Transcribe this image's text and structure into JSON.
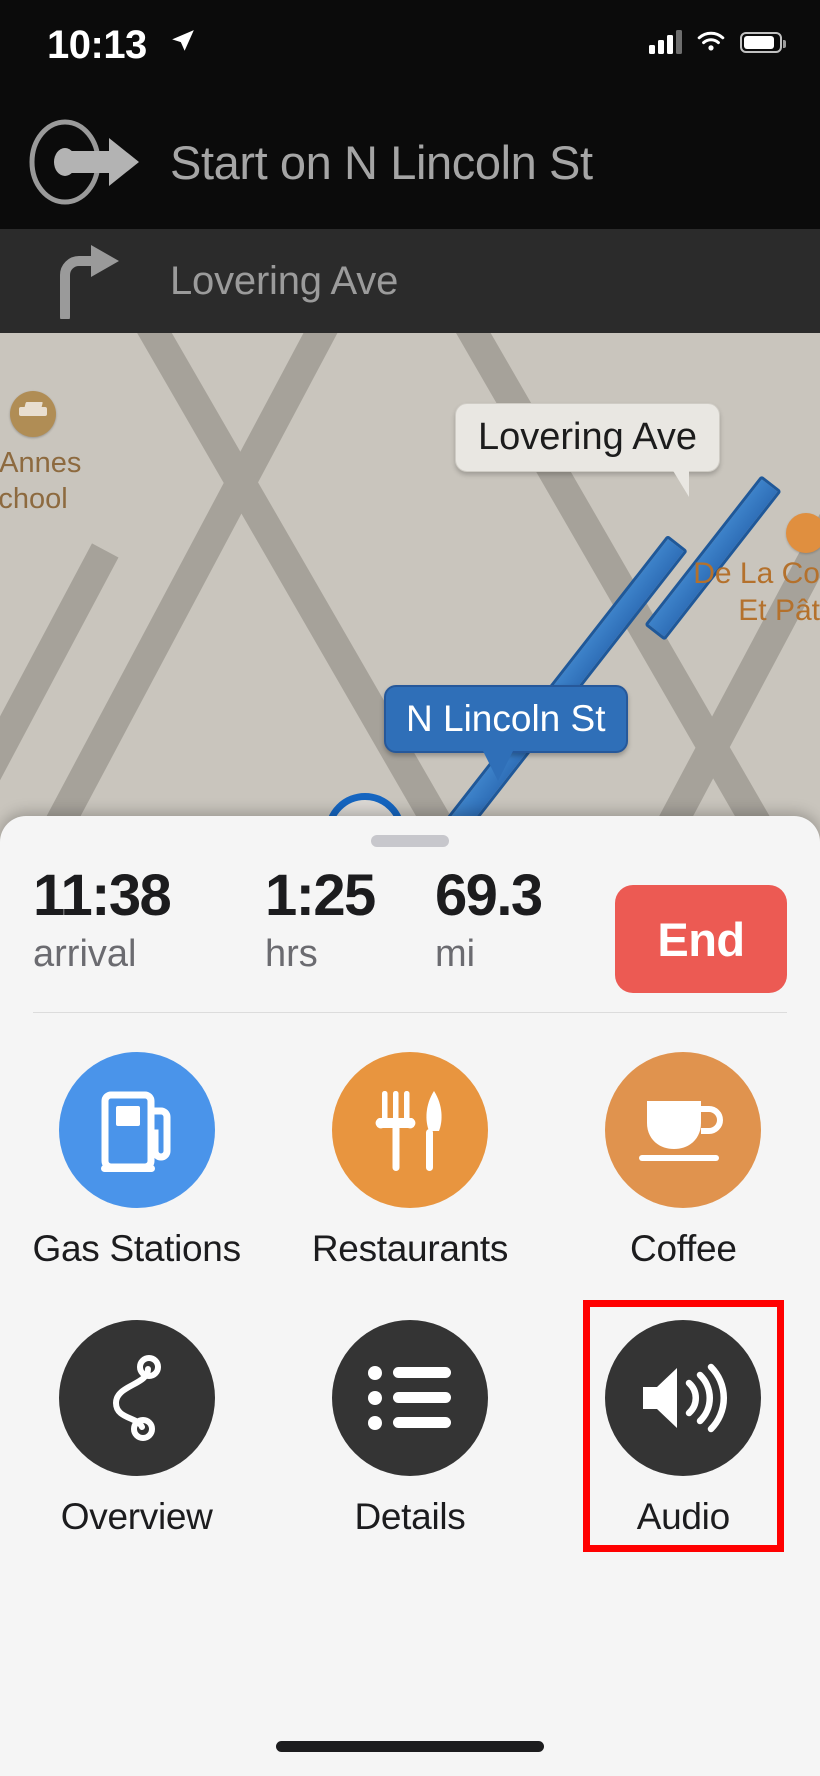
{
  "status_bar": {
    "time": "10:13",
    "location_icon": "location-arrow-icon",
    "cellular_icon": "cellular-bars-icon",
    "wifi_icon": "wifi-icon",
    "battery_icon": "battery-icon"
  },
  "navigation": {
    "primary": {
      "instruction": "Start on N Lincoln St",
      "maneuver_icon": "depart-arrow-icon"
    },
    "secondary": {
      "instruction": "Lovering Ave",
      "maneuver_icon": "turn-right-icon"
    }
  },
  "map": {
    "poi_school": {
      "line1": "t Annes",
      "line2": "chool",
      "icon": "school-graduation-cap-icon"
    },
    "poi_patisserie": {
      "line1": "De La Co",
      "line2": "Et Pât",
      "icon": "cafe-pin-icon"
    },
    "street_callout_lovering": "Lovering Ave",
    "street_callout_lincoln": "N Lincoln St",
    "user_location_icon": "location-puck-icon",
    "route_color": "#2f6fb8"
  },
  "sheet": {
    "grabber_icon": "sheet-grabber-handle",
    "stats": [
      {
        "value": "11:38",
        "unit": "arrival"
      },
      {
        "value": "1:25",
        "unit": "hrs"
      },
      {
        "value": "69.3",
        "unit": "mi"
      }
    ],
    "end_button": {
      "label": "End",
      "color": "#ec5a53"
    },
    "actions": [
      {
        "label": "Gas Stations",
        "icon": "gas-pump-icon",
        "color": "#4a94ea"
      },
      {
        "label": "Restaurants",
        "icon": "fork-knife-icon",
        "color": "#e8953f"
      },
      {
        "label": "Coffee",
        "icon": "coffee-cup-icon",
        "color": "#e0934e"
      },
      {
        "label": "Overview",
        "icon": "route-overview-icon",
        "color": "#343434"
      },
      {
        "label": "Details",
        "icon": "list-details-icon",
        "color": "#343434"
      },
      {
        "label": "Audio",
        "icon": "speaker-volume-icon",
        "color": "#343434"
      }
    ],
    "highlight": {
      "target": "Audio",
      "color": "#ff0000"
    }
  },
  "home_indicator": "home-indicator"
}
